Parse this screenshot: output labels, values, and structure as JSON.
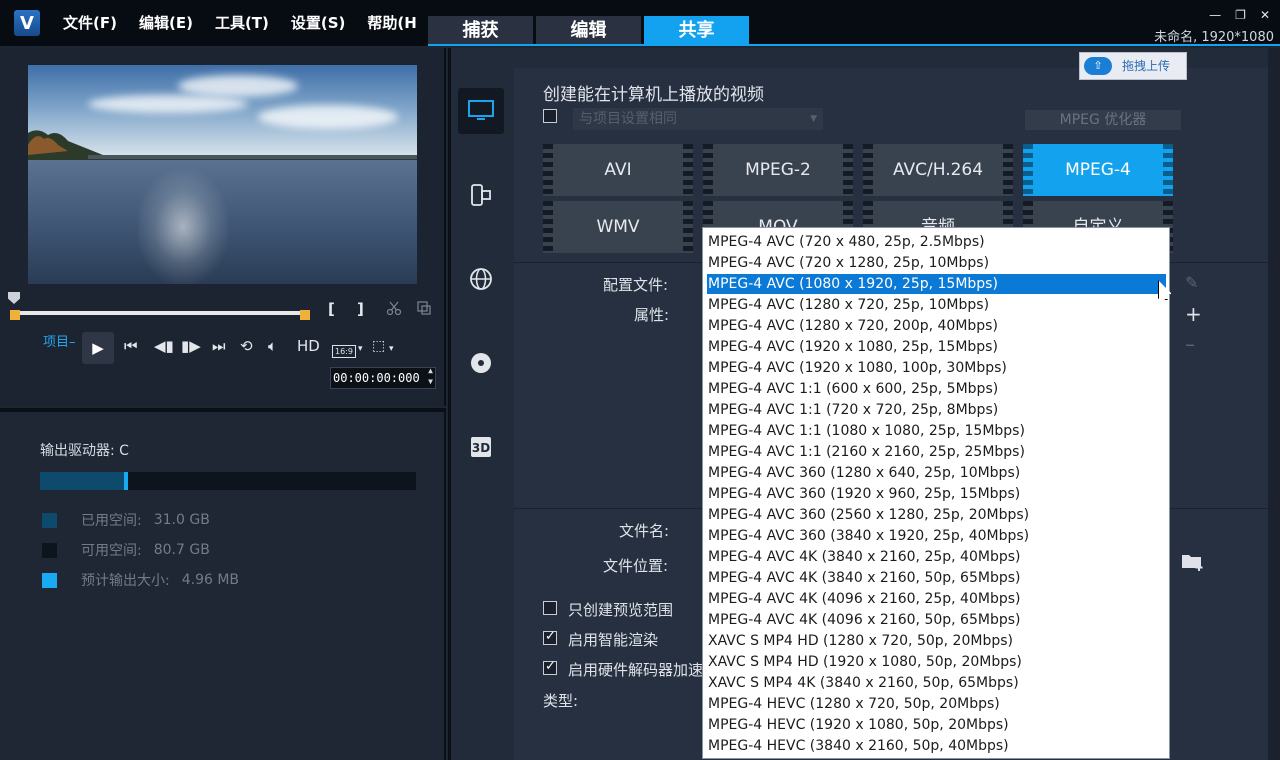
{
  "app": {
    "logo_text": "V",
    "menu": [
      "文件(F)",
      "编辑(E)",
      "工具(T)",
      "设置(S)",
      "帮助(H"
    ],
    "tabs": [
      "捕获",
      "编辑",
      "共享"
    ],
    "active_tab": "共享",
    "project_info": "未命名, 1920*1080",
    "window_controls": [
      "minimize-icon",
      "restore-icon",
      "close-icon"
    ]
  },
  "player": {
    "project_label": "项目–",
    "hd_label": "HD",
    "aspect_label": "16:9",
    "timecode": "00:00:00:000",
    "bracket_in": "[",
    "bracket_out": "]"
  },
  "drive": {
    "label": "输出驱动器: C",
    "used_fraction": 0.28,
    "legend": [
      {
        "label": "已用空间:",
        "value": "31.0 GB",
        "color": "#0e4a6c"
      },
      {
        "label": "可用空间:",
        "value": "80.7 GB",
        "color": "#0d141d"
      },
      {
        "label": "预计输出大小:",
        "value": "4.96 MB",
        "color": "#18aaf2"
      }
    ]
  },
  "share": {
    "heading": "创建能在计算机上播放的视频",
    "same_as_project": "与项目设置相同",
    "mpeg_optimizer": "MPEG 优化器",
    "upload_button": "拖拽上传",
    "formats_row1": [
      "AVI",
      "MPEG-2",
      "AVC/H.264",
      "MPEG-4"
    ],
    "formats_row2": [
      "WMV",
      "MOV",
      "音频",
      "自定义"
    ],
    "active_format": "MPEG-4",
    "profile_label": "配置文件:",
    "properties_label": "属性:",
    "filename_label": "文件名:",
    "location_label": "文件位置:",
    "preview_range": "只创建预览范围",
    "smart_render": "启用智能渲染",
    "hw_decoder": "启用硬件解码器加速",
    "type_label": "类型:"
  },
  "dropdown": {
    "selected_index": 2,
    "items": [
      "MPEG-4 AVC (720 x 480, 25p, 2.5Mbps)",
      "MPEG-4 AVC (720 x 1280, 25p, 10Mbps)",
      "MPEG-4 AVC (1080 x 1920, 25p, 15Mbps)",
      "MPEG-4 AVC (1280 x 720, 25p, 10Mbps)",
      "MPEG-4 AVC (1280 x 720, 200p, 40Mbps)",
      "MPEG-4 AVC (1920 x 1080, 25p, 15Mbps)",
      "MPEG-4 AVC (1920 x 1080, 100p, 30Mbps)",
      "MPEG-4 AVC 1:1 (600 x 600, 25p, 5Mbps)",
      "MPEG-4 AVC 1:1 (720 x 720, 25p, 8Mbps)",
      "MPEG-4 AVC 1:1 (1080 x 1080, 25p, 15Mbps)",
      "MPEG-4 AVC 1:1 (2160 x 2160, 25p, 25Mbps)",
      "MPEG-4 AVC 360 (1280 x 640, 25p, 10Mbps)",
      "MPEG-4 AVC 360 (1920 x 960, 25p, 15Mbps)",
      "MPEG-4 AVC 360 (2560 x 1280, 25p, 20Mbps)",
      "MPEG-4 AVC 360 (3840 x 1920, 25p, 40Mbps)",
      "MPEG-4 AVC 4K (3840 x 2160, 25p, 40Mbps)",
      "MPEG-4 AVC 4K (3840 x 2160, 50p, 65Mbps)",
      "MPEG-4 AVC 4K (4096 x 2160, 25p, 40Mbps)",
      "MPEG-4 AVC 4K (4096 x 2160, 50p, 65Mbps)",
      "XAVC S MP4 HD (1280 x 720, 50p, 20Mbps)",
      "XAVC S MP4 HD (1920 x 1080, 50p, 20Mbps)",
      "XAVC S MP4 4K (3840 x 2160, 50p, 65Mbps)",
      "MPEG-4 HEVC (1280 x 720, 50p, 20Mbps)",
      "MPEG-4 HEVC (1920 x 1080, 50p, 20Mbps)",
      "MPEG-4 HEVC (3840 x 2160, 50p, 40Mbps)"
    ]
  },
  "colors": {
    "accent": "#12a2ef",
    "selection": "#0b79d6",
    "background": "#1e2633"
  }
}
